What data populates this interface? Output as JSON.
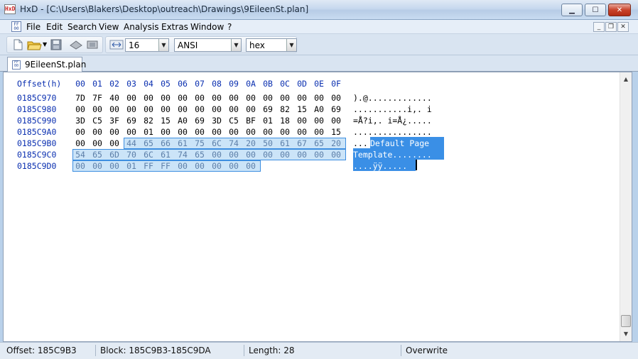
{
  "window": {
    "title": "HxD - [C:\\Users\\Blakers\\Desktop\\outreach\\Drawings\\9EileenSt.plan]",
    "app_icon_text": "HxD",
    "buttons": [
      "minimize",
      "maximize",
      "close"
    ]
  },
  "menu": {
    "items": [
      "File",
      "Edit",
      "Search",
      "View",
      "Analysis",
      "Extras",
      "Window",
      "?"
    ]
  },
  "toolbar": {
    "bytes_per_row": "16",
    "charset": "ANSI",
    "offset_base": "hex"
  },
  "tab": {
    "label": "9EileenSt.plan"
  },
  "editor": {
    "offset_header": "Offset(h)",
    "columns": [
      "00",
      "01",
      "02",
      "03",
      "04",
      "05",
      "06",
      "07",
      "08",
      "09",
      "0A",
      "0B",
      "0C",
      "0D",
      "0E",
      "0F"
    ],
    "rows": [
      {
        "offset": "0185C970",
        "bytes": [
          "7D",
          "7F",
          "40",
          "00",
          "00",
          "00",
          "00",
          "00",
          "00",
          "00",
          "00",
          "00",
          "00",
          "00",
          "00",
          "00"
        ],
        "ascii": ").@............."
      },
      {
        "offset": "0185C980",
        "bytes": [
          "00",
          "00",
          "00",
          "00",
          "00",
          "00",
          "00",
          "00",
          "00",
          "00",
          "00",
          "69",
          "82",
          "15",
          "A0",
          "69"
        ],
        "ascii": "...........i,. i"
      },
      {
        "offset": "0185C990",
        "bytes": [
          "3D",
          "C5",
          "3F",
          "69",
          "82",
          "15",
          "A0",
          "69",
          "3D",
          "C5",
          "BF",
          "01",
          "18",
          "00",
          "00",
          "00"
        ],
        "ascii": "=Å?i,. i=Å¿....."
      },
      {
        "offset": "0185C9A0",
        "bytes": [
          "00",
          "00",
          "00",
          "00",
          "01",
          "00",
          "00",
          "00",
          "00",
          "00",
          "00",
          "00",
          "00",
          "00",
          "00",
          "15"
        ],
        "ascii": "................"
      },
      {
        "offset": "0185C9B0",
        "bytes": [
          "00",
          "00",
          "00",
          "44",
          "65",
          "66",
          "61",
          "75",
          "6C",
          "74",
          "20",
          "50",
          "61",
          "67",
          "65",
          "20"
        ],
        "ascii": "...Default Page "
      },
      {
        "offset": "0185C9C0",
        "bytes": [
          "54",
          "65",
          "6D",
          "70",
          "6C",
          "61",
          "74",
          "65",
          "00",
          "00",
          "00",
          "00",
          "00",
          "00",
          "00",
          "00"
        ],
        "ascii": "Template........"
      },
      {
        "offset": "0185C9D0",
        "bytes": [
          "00",
          "00",
          "00",
          "01",
          "FF",
          "FF",
          "00",
          "00",
          "00",
          "00",
          "00"
        ],
        "ascii": "....ÿÿ....."
      }
    ]
  },
  "status": {
    "offset": "Offset: 185C9B3",
    "block": "Block: 185C9B3-185C9DA",
    "length": "Length: 28",
    "mode": "Overwrite"
  }
}
